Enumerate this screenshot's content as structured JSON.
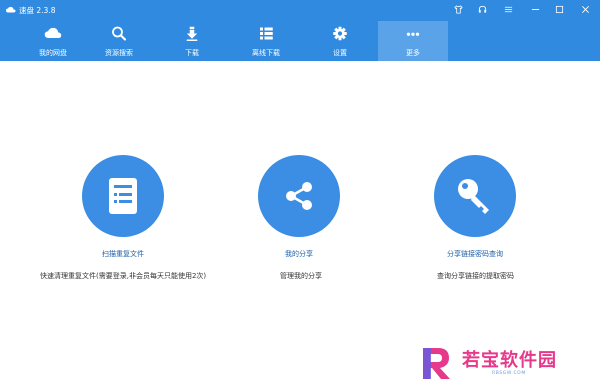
{
  "app": {
    "title": "速盘 2.3.8"
  },
  "nav": {
    "items": [
      {
        "label": "我的网盘",
        "icon": "cloud-icon"
      },
      {
        "label": "资源搜索",
        "icon": "search-icon"
      },
      {
        "label": "下载",
        "icon": "download-icon"
      },
      {
        "label": "离线下载",
        "icon": "list-icon"
      },
      {
        "label": "设置",
        "icon": "gear-icon"
      },
      {
        "label": "更多",
        "icon": "more-icon"
      }
    ],
    "active": "更多"
  },
  "cards": [
    {
      "title": "扫描重复文件",
      "desc": "快速清理重复文件(需要登录,非会员每天只能使用2次)",
      "icon": "document-list-icon"
    },
    {
      "title": "我的分享",
      "desc": "管理我的分享",
      "icon": "share-icon"
    },
    {
      "title": "分享链接密码查询",
      "desc": "查询分享链接的提取密码",
      "icon": "key-icon"
    }
  ],
  "watermark": {
    "text": "若宝软件园",
    "sub": "RBSGW.COM"
  },
  "colors": {
    "accent": "#2f8ae0",
    "active_tab": "#5aa3e8",
    "circle": "#3b8ee3",
    "card_title": "#1b5ea9",
    "watermark": "#e6398b"
  }
}
